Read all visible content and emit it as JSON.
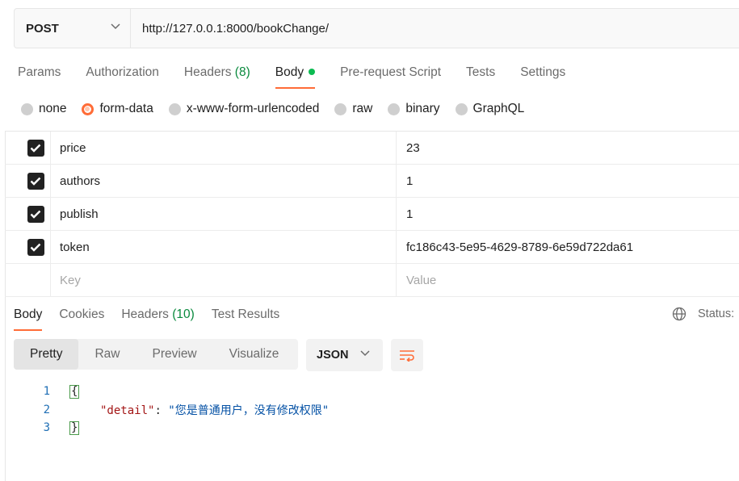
{
  "request": {
    "method": "POST",
    "url": "http://127.0.0.1:8000/bookChange/"
  },
  "request_tabs": [
    {
      "label": "Params"
    },
    {
      "label": "Authorization"
    },
    {
      "label": "Headers",
      "count": "(8)"
    },
    {
      "label": "Body",
      "active": true
    },
    {
      "label": "Pre-request Script"
    },
    {
      "label": "Tests"
    },
    {
      "label": "Settings"
    }
  ],
  "body_types": [
    "none",
    "form-data",
    "x-www-form-urlencoded",
    "raw",
    "binary",
    "GraphQL"
  ],
  "body_type_selected": "form-data",
  "form_rows": [
    {
      "key": "price",
      "value": "23",
      "checked": true
    },
    {
      "key": "authors",
      "value": "1",
      "checked": true
    },
    {
      "key": "publish",
      "value": "1",
      "checked": true
    },
    {
      "key": "token",
      "value": "fc186c43-5e95-4629-8789-6e59d722da61",
      "checked": true
    }
  ],
  "form_placeholder": {
    "key": "Key",
    "value": "Value"
  },
  "response_tabs": [
    {
      "label": "Body",
      "active": true
    },
    {
      "label": "Cookies"
    },
    {
      "label": "Headers",
      "count": "(10)"
    },
    {
      "label": "Test Results"
    }
  ],
  "status_label": "Status:",
  "view_modes": [
    "Pretty",
    "Raw",
    "Preview",
    "Visualize"
  ],
  "view_mode_selected": "Pretty",
  "format": "JSON",
  "response_code": {
    "line_numbers": [
      "1",
      "2",
      "3"
    ],
    "open_brace": "{",
    "close_brace": "}",
    "key": "\"detail\"",
    "colon": ": ",
    "value": "\"您是普通用户，没有修改权限\""
  },
  "colors": {
    "accent": "#ff6c37",
    "body_dot": "#0cbb52",
    "count_green": "#0a8a3e"
  },
  "icons": {
    "method_dropdown": "chevron-down-icon",
    "format_dropdown": "chevron-down-icon",
    "wrap": "wrap-lines-icon",
    "globe": "globe-icon",
    "checkbox": "check-icon"
  }
}
